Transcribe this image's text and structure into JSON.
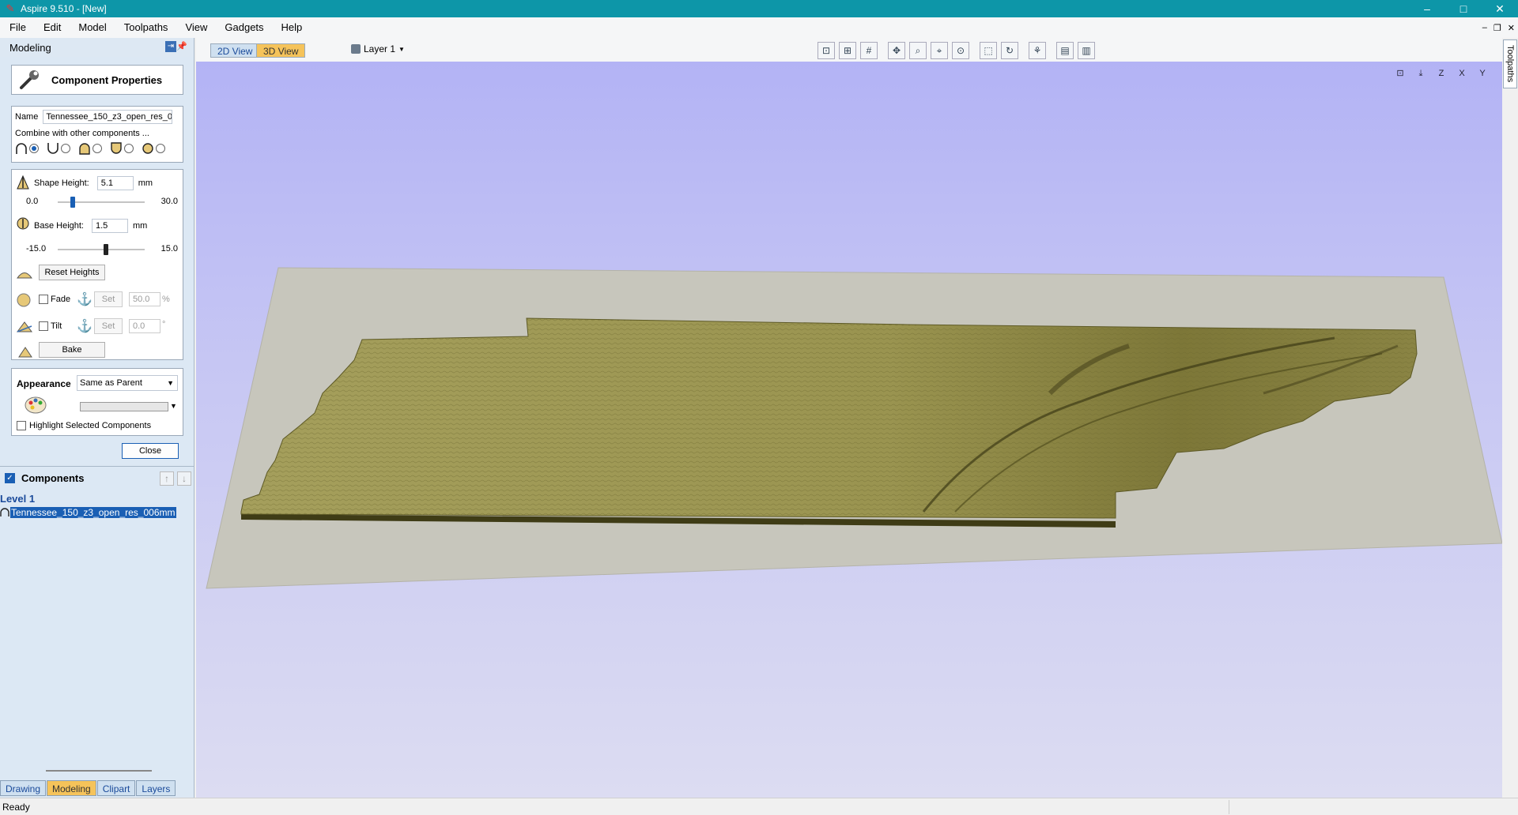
{
  "window": {
    "title": "Aspire 9.510 - [New]",
    "minimize": "–",
    "maximize": "□",
    "close": "✕"
  },
  "menu": {
    "items": [
      "File",
      "Edit",
      "Model",
      "Toolpaths",
      "View",
      "Gadgets",
      "Help"
    ],
    "mdi": {
      "minimize": "–",
      "restore": "❐",
      "close": "✕"
    }
  },
  "panel": {
    "title": "Modeling",
    "component_properties": "Component Properties",
    "name_label": "Name",
    "name_value": "Tennessee_150_z3_open_res_006mm",
    "combine_label": "Combine with other components ...",
    "shape_height": {
      "label": "Shape Height:",
      "value": "5.1",
      "unit": "mm",
      "min": "0.0",
      "max": "30.0",
      "level": 0.17
    },
    "base_height": {
      "label": "Base Height:",
      "value": "1.5",
      "unit": "mm",
      "min": "-15.0",
      "max": "15.0",
      "level": 0.55
    },
    "reset_heights": "Reset Heights",
    "fade": {
      "label": "Fade",
      "set": "Set",
      "value": "50.0",
      "unit": "%"
    },
    "tilt": {
      "label": "Tilt",
      "set": "Set",
      "value": "0.0",
      "unit": "°"
    },
    "bake": "Bake",
    "appearance": {
      "label": "Appearance",
      "value": "Same as Parent",
      "highlight": "Highlight Selected Components"
    },
    "close": "Close"
  },
  "components": {
    "title": "Components",
    "level": "Level 1",
    "item": "Tennessee_150_z3_open_res_006mm"
  },
  "bottom_tabs": [
    "Drawing",
    "Modeling",
    "Clipart",
    "Layers"
  ],
  "view_tabs": {
    "v2d": "2D View",
    "v3d": "3D View"
  },
  "layer": "Layer 1",
  "right_tab": "Toolpaths",
  "status": "Ready",
  "colors": {
    "titlebar": "#0d96a8",
    "accent": "#f5c35a",
    "terrain": "#9a9450",
    "plane": "#c7c6bc"
  }
}
